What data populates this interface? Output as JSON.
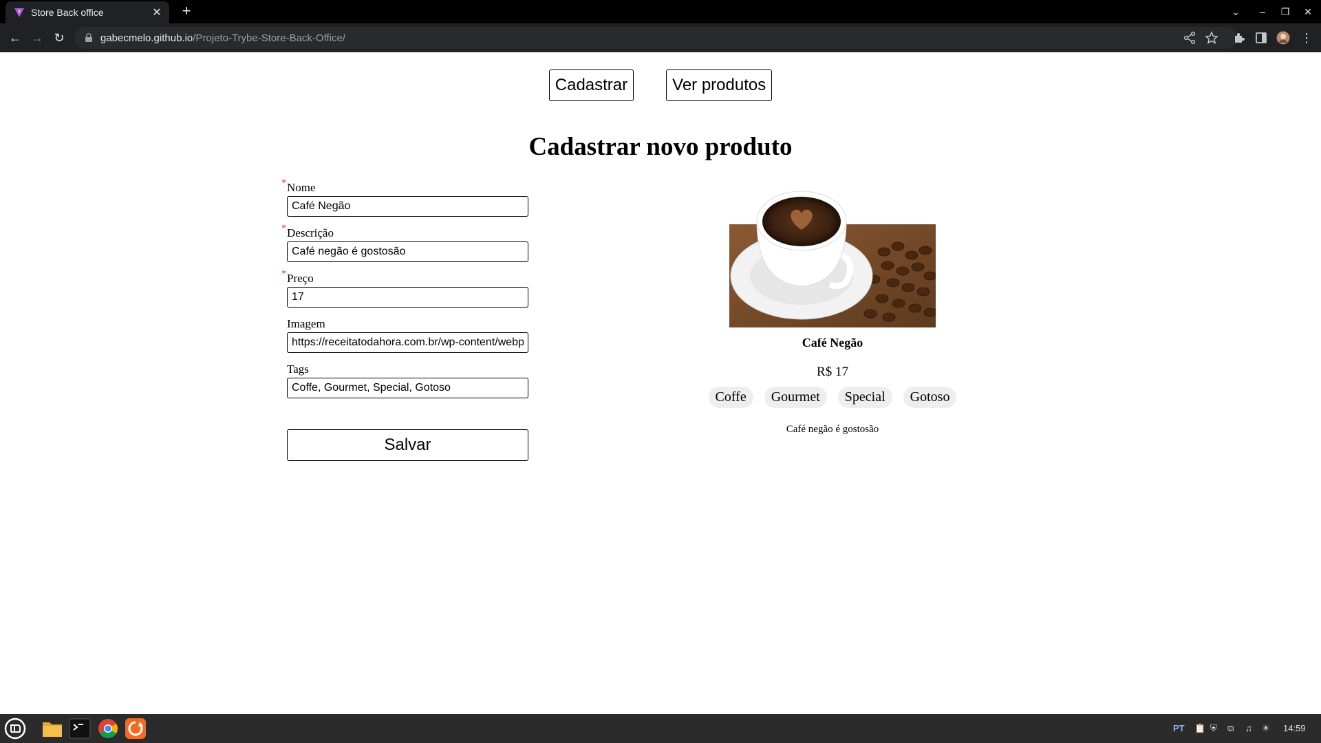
{
  "browser": {
    "tab_title": "Store Back office",
    "url_host": "gabecmelo.github.io",
    "url_path": "/Projeto-Trybe-Store-Back-Office/"
  },
  "nav": {
    "register_label": "Cadastrar",
    "view_products_label": "Ver produtos"
  },
  "page_title": "Cadastrar novo produto",
  "form": {
    "required_mark": "*",
    "name_label": "Nome",
    "name_value": "Café Negão",
    "description_label": "Descrição",
    "description_value": "Café negão é gostosão",
    "price_label": "Preço",
    "price_value": "17",
    "image_label": "Imagem",
    "image_value": "https://receitatodahora.com.br/wp-content/webp",
    "tags_label": "Tags",
    "tags_value": "Coffe, Gourmet, Special, Gotoso",
    "save_label": "Salvar"
  },
  "preview": {
    "name": "Café Negão",
    "price": "R$ 17",
    "tags": [
      "Coffe",
      "Gourmet",
      "Special",
      "Gotoso"
    ],
    "description": "Café negão é gostosão"
  },
  "taskbar": {
    "language": "PT",
    "clock": "14:59"
  },
  "colors": {
    "required": "#e53935",
    "tag_bg": "#eeeeee",
    "chrome_bg": "#202124",
    "taskbar_bg": "#2b2b2b"
  }
}
